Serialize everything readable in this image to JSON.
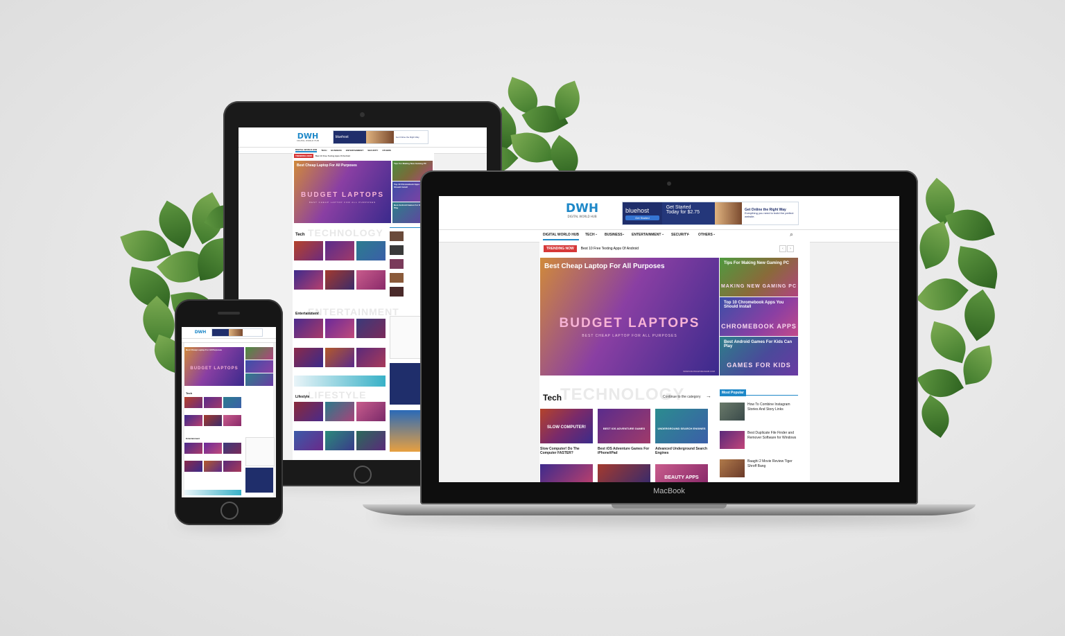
{
  "site": {
    "logo": "DWH",
    "logo_sub": "DIGITAL WORLD HUB",
    "ad": {
      "brand": "bluehost",
      "headline": "Get Started",
      "price": "Today for $2.75",
      "button": "Get Started",
      "side_title": "Get Online the Right Way",
      "side_text": "Everything you need to build the perfect website."
    },
    "nav": [
      "DIGITAL WORLD HUB",
      "TECH",
      "BUSINESS",
      "ENTERTAINMENT",
      "SECURITY",
      "OTHERS"
    ],
    "trending_label": "TRENDING NOW",
    "trending_text": "Best 10 Free Texting Apps Of Android",
    "hero": {
      "title": "Best Cheap Laptop For All Purposes",
      "big": "BUDGET LAPTOPS",
      "sub": "BEST CHEAP LAPTOP FOR ALL PURPOSES",
      "url": "WWW.DIGITALWORLDHUB.COM"
    },
    "side_cards": [
      {
        "title": "Tips For Making New Gaming PC",
        "banner": "MAKING NEW GAMING PC"
      },
      {
        "title": "Top 10 Chromebook Apps You Should Install",
        "banner": "CHROMEBOOK APPS"
      },
      {
        "title": "Best Android Games For Kids Can Play",
        "banner": "GAMES FOR KIDS"
      }
    ],
    "tech_section": {
      "title": "Tech",
      "ghost": "TECHNOLOGY",
      "more": "Continue to the category"
    },
    "tech_posts": [
      {
        "banner": "SLOW COMPUTER!",
        "caption": "Slow Computer! Do The Computer FASTER?"
      },
      {
        "banner": "BEST IOS ADVENTURE GAMES",
        "caption": "Best iOS Adventure Games For iPhone/iPad"
      },
      {
        "banner": "UNDERGROUND SEARCH ENGINES",
        "caption": "Advanced Underground Search Engines"
      }
    ],
    "row2_banner": "BEAUTY APPS",
    "popular": {
      "title": "Most Popular",
      "items": [
        "How To Combine Instagram Stories And Story Links",
        "Best Duplicate File Finder and Remover Software for Windows",
        "Baaghi 2 Movie Review Tiger Shroff Bang"
      ]
    },
    "tablet_sections": [
      "Tech",
      "Entertainment",
      "Lifestyle"
    ],
    "tablet_ghosts": [
      "TECHNOLOGY",
      "ENTERTAINMENT",
      "LIFESTYLE"
    ],
    "phone_sections": [
      "Tech",
      "Entertainment"
    ]
  },
  "device_label": "MacBook",
  "colors": {
    "accent": "#1e88c8",
    "trend_red": "#d63838",
    "hero_start": "#d08a3a",
    "hero_mid": "#8a3fa3",
    "hero_end": "#3a2a8c"
  }
}
